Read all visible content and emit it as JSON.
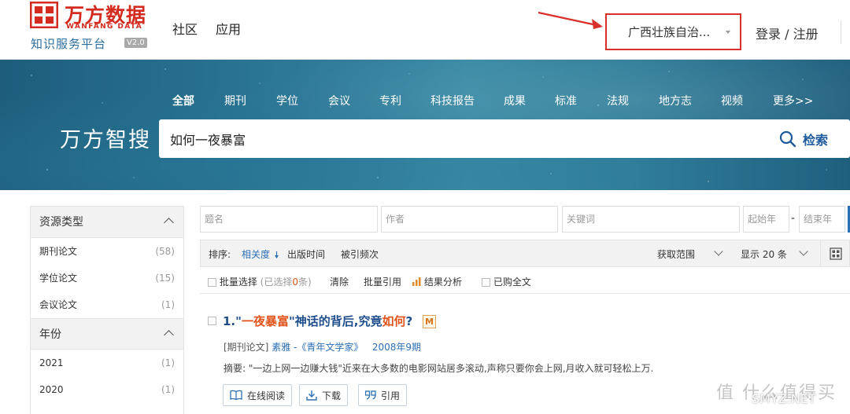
{
  "logo": {
    "cn": "万方数据",
    "en": "WANFANG DATA",
    "sub": "知识服务平台",
    "version": "V2.0"
  },
  "topnav": [
    "社区",
    "应用"
  ],
  "region": {
    "selected": "广西壮族自治..."
  },
  "auth": {
    "label": "登录 / 注册"
  },
  "categories": [
    "全部",
    "期刊",
    "学位",
    "会议",
    "专利",
    "科技报告",
    "成果",
    "标准",
    "法规",
    "地方志",
    "视频",
    "更多>>"
  ],
  "brand": "万方智搜",
  "search": {
    "query": "如何一夜暴富",
    "button_label": "检索"
  },
  "sidebar": {
    "sections": [
      {
        "title": "资源类型",
        "items": [
          {
            "label": "期刊论文",
            "count": "(58)"
          },
          {
            "label": "学位论文",
            "count": "(15)"
          },
          {
            "label": "会议论文",
            "count": "(1)"
          }
        ]
      },
      {
        "title": "年份",
        "items": [
          {
            "label": "2021",
            "count": "(1)"
          },
          {
            "label": "2020",
            "count": "(1)"
          }
        ]
      }
    ]
  },
  "filters": {
    "title_ph": "题名",
    "author_ph": "作者",
    "keyword_ph": "关键词",
    "start_year_ph": "起始年",
    "dash": "-",
    "end_year_ph": "结束年"
  },
  "sortbar": {
    "label": "排序:",
    "relevance": "相关度",
    "pubtime": "出版时间",
    "cited": "被引频次",
    "scope": "获取范围",
    "pagesize": "显示 20 条"
  },
  "batch": {
    "select_all": "批量选择",
    "selected": "(已选择",
    "selected_count": "0",
    "selected_unit": "条)",
    "clear": "清除",
    "cite": "批量引用",
    "analysis": "结果分析",
    "purchased": "已购全文"
  },
  "result": {
    "index": "1.",
    "q_open": "\"",
    "hl1": "一夜暴富",
    "mid": "\"神话的背后,究竟",
    "hl2": "如何",
    "end": "?",
    "badge": "M",
    "type": "[期刊论文]",
    "author": "素雅",
    "journal": "-《青年文学家》",
    "date": "2008年9期",
    "abstract_label": "摘要:",
    "abstract": "\"一边上网一边赚大钱\"近来在大多数的电影网站居多滚动,声称只要你会上网,月收入就可轻松上万.",
    "btn_read": "在线阅读",
    "btn_download": "下载",
    "btn_cite": "引用"
  },
  "watermark": {
    "text": "值 什么值得买",
    "sub": "SMYZ.NET"
  }
}
